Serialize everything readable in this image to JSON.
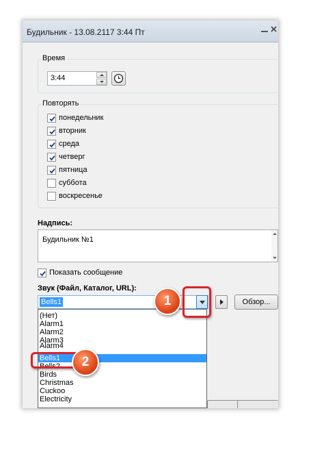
{
  "window": {
    "title": "Будильник - 13.08.2117 3:44 Пт"
  },
  "time_group": {
    "legend": "Время",
    "value": "3:44"
  },
  "repeat_group": {
    "legend": "Повторять",
    "days": [
      {
        "label": "понедельник",
        "checked": true
      },
      {
        "label": "вторник",
        "checked": true
      },
      {
        "label": "среда",
        "checked": true
      },
      {
        "label": "четверг",
        "checked": true
      },
      {
        "label": "пятница",
        "checked": true
      },
      {
        "label": "суббота",
        "checked": false
      },
      {
        "label": "воскресенье",
        "checked": false
      }
    ]
  },
  "caption": {
    "label": "Надпись:",
    "value": "Будильник №1"
  },
  "show_message": {
    "label": "Показать сообщение",
    "checked": true
  },
  "sound": {
    "label": "Звук (Файл, Каталог, URL):",
    "selected": "Bells1",
    "browse_label": "Обзор...",
    "options": [
      "(Нет)",
      "Alarm1",
      "Alarm2",
      "Alarm3",
      "Alarm4",
      "Bells1",
      "Bells2",
      "Birds",
      "Christmas",
      "Cuckoo",
      "Electricity"
    ],
    "highlighted_index": 5
  },
  "annotations": {
    "step1": "1",
    "step2": "2"
  },
  "colors": {
    "selection": "#3399ff",
    "callout": "#e0491c",
    "highlight_frame": "#d8242b"
  },
  "icons": {
    "clock_button": "clock-icon",
    "play_button": "play-icon",
    "dropdown_button": "chevron-down-icon"
  }
}
